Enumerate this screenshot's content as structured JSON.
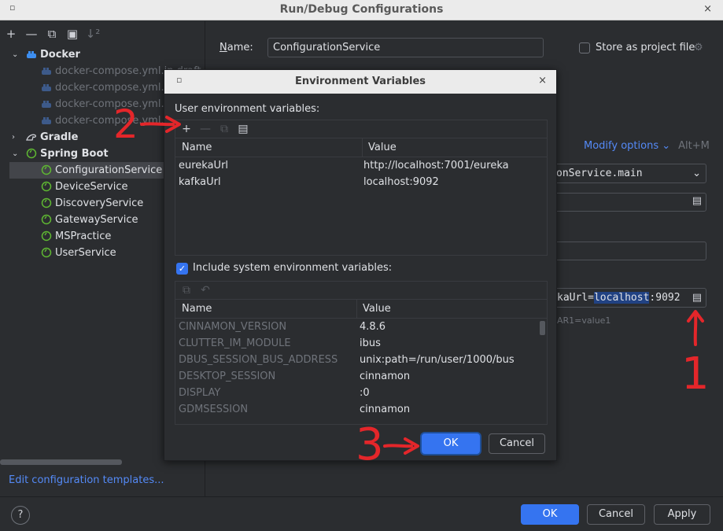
{
  "window": {
    "title": "Run/Debug Configurations",
    "menu_glyph": "▫",
    "close_glyph": "×"
  },
  "left_panel": {
    "toolbar": [
      "+",
      "—",
      "⧉",
      "▣",
      "↓²"
    ],
    "tree": [
      {
        "label": "Docker",
        "level": 0,
        "expanded": true,
        "icon": "docker-icon"
      },
      {
        "label": "docker-compose.yml.in.draft",
        "level": 1,
        "dim": true,
        "icon": "docker-compose-icon"
      },
      {
        "label": "docker-compose.yml.k",
        "level": 1,
        "dim": true,
        "icon": "docker-compose-icon"
      },
      {
        "label": "docker-compose.yml.k",
        "level": 1,
        "dim": true,
        "icon": "docker-compose-icon"
      },
      {
        "label": "docker-compose.yml.k",
        "level": 1,
        "dim": true,
        "icon": "docker-compose-icon"
      },
      {
        "label": "Gradle",
        "level": 0,
        "expanded": false,
        "icon": "gradle-icon"
      },
      {
        "label": "Spring Boot",
        "level": 0,
        "expanded": true,
        "icon": "spring-boot-icon"
      },
      {
        "label": "ConfigurationService",
        "level": 1,
        "selected": true,
        "icon": "spring-boot-icon"
      },
      {
        "label": "DeviceService",
        "level": 1,
        "icon": "spring-boot-icon"
      },
      {
        "label": "DiscoveryService",
        "level": 1,
        "icon": "spring-boot-icon"
      },
      {
        "label": "GatewayService",
        "level": 1,
        "icon": "spring-boot-icon"
      },
      {
        "label": "MSPractice",
        "level": 1,
        "icon": "spring-boot-icon"
      },
      {
        "label": "UserService",
        "level": 1,
        "icon": "spring-boot-icon"
      }
    ],
    "templates_link": "Edit configuration templates..."
  },
  "config": {
    "name_label": "Name:",
    "name_value": "ConfigurationService",
    "store_label": "Store as project file",
    "modify_options": "Modify options",
    "modify_shortcut": "Alt+M",
    "main_class": "onService.main",
    "env_prefix": "kaUrl=",
    "env_highlight": "localhost",
    "env_suffix": ":9092",
    "env_hint": "AR1=value1"
  },
  "footer": {
    "help": "?",
    "ok": "OK",
    "cancel": "Cancel",
    "apply": "Apply"
  },
  "dialog": {
    "title": "Environment Variables",
    "menu_glyph": "▫",
    "close_glyph": "×",
    "user_label": "User environment variables:",
    "user_toolbar": [
      "+",
      "—",
      "⧉",
      "📋"
    ],
    "col_name": "Name",
    "col_value": "Value",
    "user_vars": [
      {
        "name": "eurekaUrl",
        "value": "http://localhost:7001/eureka"
      },
      {
        "name": "kafkaUrl",
        "value": "localhost:9092"
      }
    ],
    "include_label": "Include system environment variables:",
    "sys_toolbar": [
      "⧉",
      "↶"
    ],
    "sys_vars": [
      {
        "name": "CINNAMON_VERSION",
        "value": "4.8.6"
      },
      {
        "name": "CLUTTER_IM_MODULE",
        "value": "ibus"
      },
      {
        "name": "DBUS_SESSION_BUS_ADDRESS",
        "value": "unix:path=/run/user/1000/bus"
      },
      {
        "name": "DESKTOP_SESSION",
        "value": "cinnamon"
      },
      {
        "name": "DISPLAY",
        "value": ":0"
      },
      {
        "name": "GDMSESSION",
        "value": "cinnamon"
      }
    ],
    "ok": "OK",
    "cancel": "Cancel"
  },
  "annotations": {
    "n1": "1",
    "n2": "2",
    "n3": "3"
  },
  "colors": {
    "accent": "#3574f0",
    "link": "#548af7",
    "annotation": "#e4262a",
    "background": "#2b2d30"
  }
}
